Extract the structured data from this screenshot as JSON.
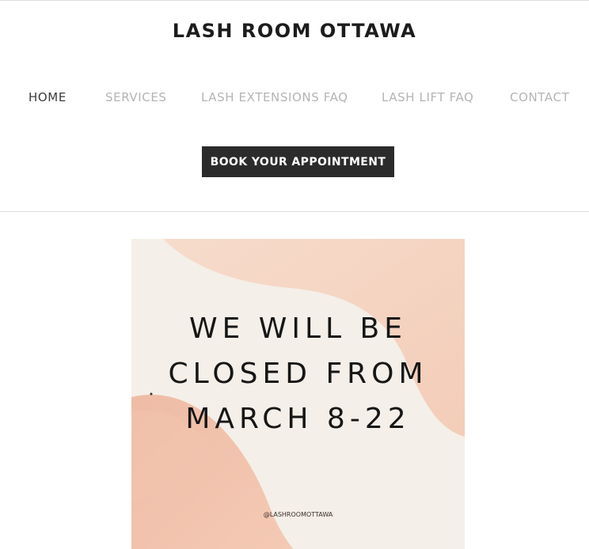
{
  "header": {
    "site_title": "LASH ROOM OTTAWA"
  },
  "nav": {
    "items": [
      {
        "label": "HOME",
        "active": true
      },
      {
        "label": "SERVICES",
        "active": false
      },
      {
        "label": "LASH EXTENSIONS FAQ",
        "active": false
      },
      {
        "label": "LASH LIFT FAQ",
        "active": false
      },
      {
        "label": "CONTACT",
        "active": false
      }
    ]
  },
  "cta": {
    "label": "BOOK YOUR APPOINTMENT"
  },
  "promo": {
    "lines": [
      "WE WILL BE",
      "CLOSED FROM",
      "MARCH 8-22"
    ],
    "handle": "@LASHROOMOTTAWA"
  },
  "colors": {
    "text_dark": "#1c1c1c",
    "nav_inactive": "#b4b4b4",
    "nav_active": "#3a3a3a",
    "button_bg": "#2b2b2b",
    "button_text": "#ffffff",
    "blush": "#f0bfa8",
    "cream": "#f4efe8"
  }
}
